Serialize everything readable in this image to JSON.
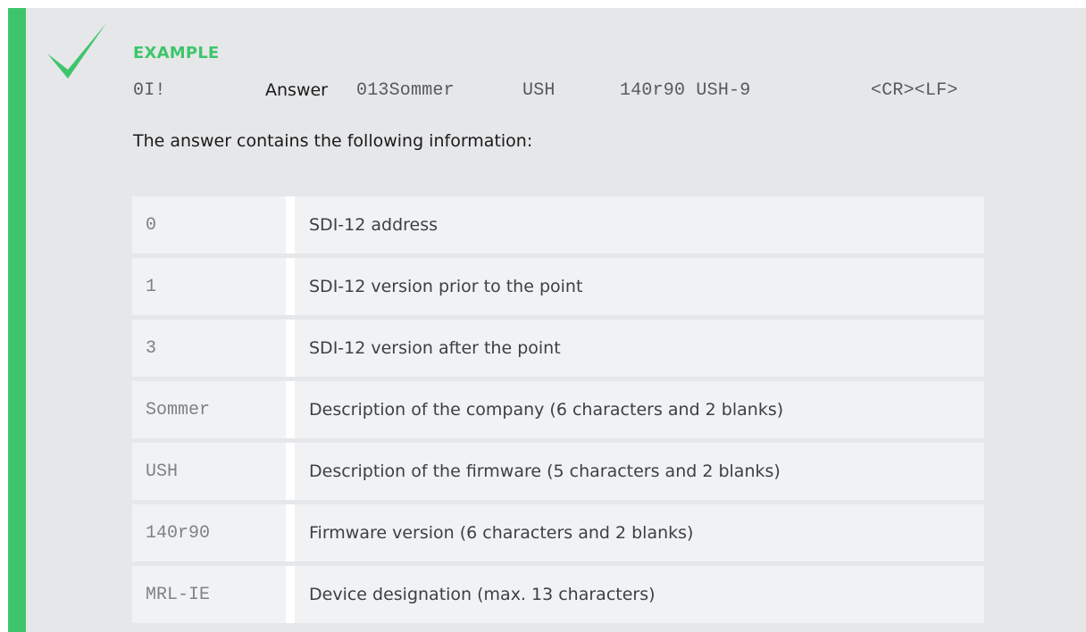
{
  "example": {
    "label": "EXAMPLE",
    "command": "0I!",
    "answer_label": "Answer",
    "answer_parts": [
      "013Sommer",
      "USH",
      "140r90 USH-9",
      "<CR><LF>"
    ]
  },
  "intro": "The answer contains the following information:",
  "rows": [
    {
      "key": "0",
      "desc": "SDI-12 address"
    },
    {
      "key": "1",
      "desc": "SDI-12 version prior to the point"
    },
    {
      "key": "3",
      "desc": "SDI-12 version after the point"
    },
    {
      "key": "Sommer",
      "desc": "Description of the company (6 characters and 2 blanks)"
    },
    {
      "key": "USH",
      "desc": "Description of the firmware (5 characters and 2 blanks)"
    },
    {
      "key": "140r90",
      "desc": "Firmware version (6 characters and 2 blanks)"
    },
    {
      "key": "MRL-IE",
      "desc": "Device designation (max. 13 characters)"
    }
  ],
  "colors": {
    "accent": "#3ec56b",
    "panel": "#e6e7e9",
    "cell": "#f1f2f3"
  },
  "icon": "checkmark-icon"
}
